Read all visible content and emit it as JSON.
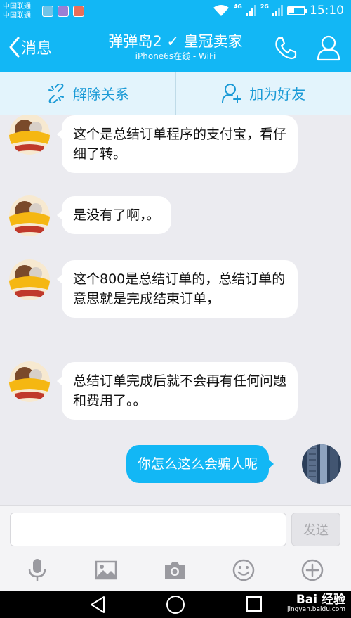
{
  "status_bar": {
    "carrier_1": "中国联通",
    "carrier_2": "中国联通",
    "network_1": "4G",
    "network_2": "2G",
    "time": "15:10",
    "battery_level": 0.3
  },
  "header": {
    "back_label": "消息",
    "title": "弹弹岛2 ✓ 皇冠卖家",
    "subtitle": "iPhone6s在线 - WiFi"
  },
  "actions": {
    "unfriend_label": "解除关系",
    "add_friend_label": "加为好友"
  },
  "messages": [
    {
      "sender": "contact",
      "text": "这个是总结订单程序的支付宝，看仔细了转。"
    },
    {
      "sender": "contact",
      "text": "是没有了啊，。"
    },
    {
      "sender": "contact",
      "text": "这个800是总结订单的，总结订单的意思就是完成结束订单，"
    },
    {
      "sender": "contact",
      "text": "总结订单完成后就不会再有任何问题和费用了。。"
    },
    {
      "sender": "self",
      "text": "你怎么这么会骗人呢"
    }
  ],
  "input": {
    "value": "",
    "send_label": "发送"
  },
  "watermark": {
    "brand": "Bai 经验",
    "url": "jingyan.baidu.com"
  },
  "colors": {
    "primary": "#12b7f5",
    "action_bar_bg": "#e3f4fc",
    "chat_bg": "#ebebf0",
    "action_text": "#1a9ad6"
  }
}
